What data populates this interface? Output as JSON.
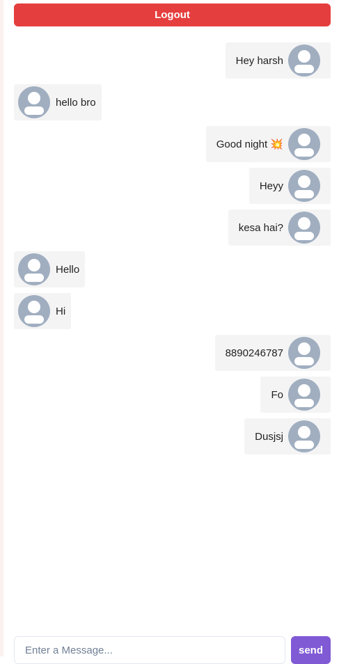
{
  "header": {
    "logout_label": "Logout",
    "logout_color": "#e53e3e"
  },
  "messages": [
    {
      "direction": "sent",
      "text": "Hey harsh",
      "avatar_icon": "user-avatar-icon"
    },
    {
      "direction": "received",
      "text": "hello bro",
      "avatar_icon": "user-avatar-icon"
    },
    {
      "direction": "sent",
      "text": "Good night 💥",
      "avatar_icon": "user-avatar-icon"
    },
    {
      "direction": "sent",
      "text": "Heyy",
      "avatar_icon": "user-avatar-icon"
    },
    {
      "direction": "sent",
      "text": "kesa hai?",
      "avatar_icon": "user-avatar-icon"
    },
    {
      "direction": "received",
      "text": "Hello",
      "avatar_icon": "user-avatar-icon"
    },
    {
      "direction": "received",
      "text": "Hi",
      "avatar_icon": "user-avatar-icon"
    },
    {
      "direction": "sent",
      "text": "8890246787",
      "avatar_icon": "user-avatar-icon"
    },
    {
      "direction": "sent",
      "text": "Fo",
      "avatar_icon": "user-avatar-icon"
    },
    {
      "direction": "sent",
      "text": "Dusjsj",
      "avatar_icon": "user-avatar-icon"
    }
  ],
  "composer": {
    "input_value": "",
    "input_placeholder": "Enter a Message...",
    "send_label": "send",
    "send_color": "#805ad5"
  }
}
